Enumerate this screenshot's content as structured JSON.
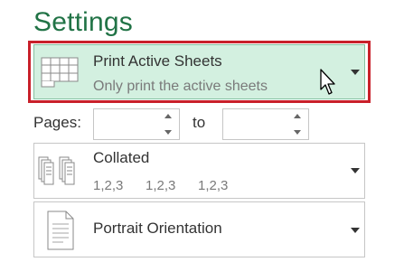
{
  "settings": {
    "heading": "Settings"
  },
  "print_what": {
    "title": "Print Active Sheets",
    "subtitle": "Only print the active sheets",
    "icon": "active-sheets-grid-icon",
    "highlight_color": "#c9202a",
    "selected_bg": "#d3f0e0"
  },
  "pages": {
    "label": "Pages:",
    "from_value": "",
    "to_label": "to",
    "to_value": ""
  },
  "collation": {
    "title": "Collated",
    "sequence": [
      "1,2,3",
      "1,2,3",
      "1,2,3"
    ],
    "icon": "collated-pages-icon"
  },
  "orientation": {
    "title": "Portrait Orientation",
    "icon": "portrait-page-icon"
  },
  "colors": {
    "accent": "#217346"
  }
}
